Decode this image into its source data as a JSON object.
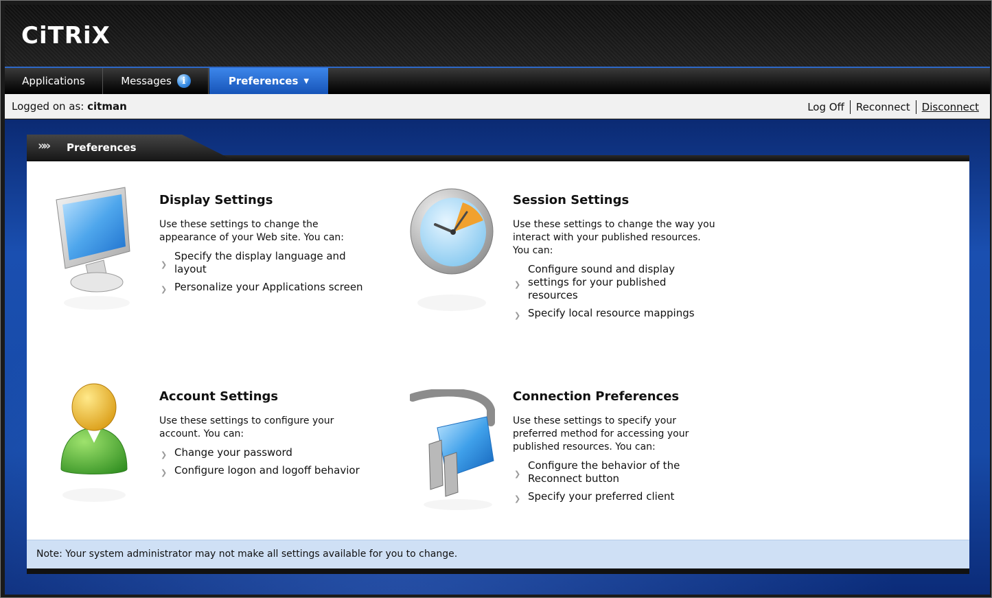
{
  "brand": {
    "logo_text": "CiTRiX"
  },
  "tabs": [
    {
      "label": "Applications"
    },
    {
      "label": "Messages",
      "badge_icon": "info-icon"
    },
    {
      "label": "Preferences",
      "active": true,
      "has_dropdown": true
    }
  ],
  "status_bar": {
    "logged_on_prefix": "Logged on as:",
    "username": "citman",
    "links": {
      "log_off": "Log Off",
      "reconnect": "Reconnect",
      "disconnect": "Disconnect"
    }
  },
  "section": {
    "title": "Preferences"
  },
  "settings": {
    "display": {
      "title": "Display Settings",
      "description": "Use these settings to change the appearance of your Web site. You can:",
      "items": [
        "Specify the display language and layout",
        "Personalize your Applications screen"
      ]
    },
    "session": {
      "title": "Session Settings",
      "description": "Use these settings to change the way you interact with your published resources. You can:",
      "items": [
        "Configure sound and display settings for your published resources",
        "Specify local resource mappings"
      ]
    },
    "account": {
      "title": "Account Settings",
      "description": "Use these settings to configure your account. You can:",
      "items": [
        "Change your password",
        "Configure logon and logoff behavior"
      ]
    },
    "connection": {
      "title": "Connection Preferences",
      "description": "Use these settings to specify your preferred method for accessing your published resources. You can:",
      "items": [
        "Configure the behavior of the Reconnect button",
        "Specify your preferred client"
      ]
    }
  },
  "note": {
    "text": "Note: Your system administrator may not make all settings available for you to change."
  },
  "colors": {
    "accent_blue": "#1654b8",
    "background_blue": "#174aa7",
    "note_background": "#cfe0f5"
  }
}
